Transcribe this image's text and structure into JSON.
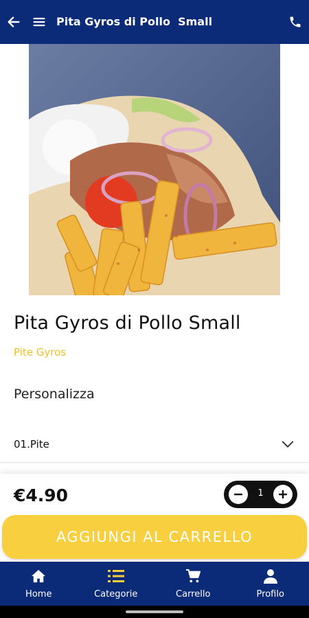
{
  "header": {
    "title": "Pita Gyros di Pollo  Small",
    "back_icon": "arrow-left-icon",
    "menu_icon": "hamburger-icon",
    "phone_icon": "phone-icon",
    "background": "#0b2a78"
  },
  "product": {
    "image": "pita-gyros-photo",
    "name": "Pita Gyros di Pollo Small",
    "category": "Pite Gyros",
    "category_color": "#f0c12d"
  },
  "customize": {
    "title": "Personalizza",
    "options": [
      {
        "label": "01.Pite",
        "icon": "chevron-down-icon"
      }
    ]
  },
  "cart_bar": {
    "price": "€4.90",
    "quantity": "1",
    "add_label": "AGGIUNGI AL CARRELLO",
    "button_color": "#f7cf3f"
  },
  "tabbar": {
    "items": [
      {
        "label": "Home",
        "icon": "home-icon"
      },
      {
        "label": "Categorie",
        "icon": "list-icon",
        "active": true
      },
      {
        "label": "Carrello",
        "icon": "cart-icon"
      },
      {
        "label": "Profilo",
        "icon": "user-icon"
      }
    ]
  }
}
